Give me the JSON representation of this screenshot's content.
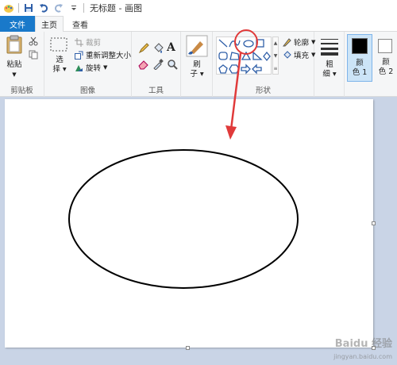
{
  "window": {
    "title": "无标题 - 画图"
  },
  "tabs": [
    {
      "label": "文件"
    },
    {
      "label": "主页"
    },
    {
      "label": "查看"
    }
  ],
  "ribbon": {
    "clipboard": {
      "paste_label": "粘贴",
      "group_label": "剪贴板"
    },
    "image": {
      "select_label_1": "选",
      "select_label_2": "择",
      "crop_label": "裁剪",
      "resize_label": "重新调整大小",
      "rotate_label": "旋转",
      "group_label": "图像"
    },
    "tools": {
      "text_tool": "A",
      "group_label": "工具"
    },
    "brushes": {
      "label_1": "刷",
      "label_2": "子"
    },
    "shapes": {
      "outline_label": "轮廓",
      "fill_label": "填充",
      "group_label": "形状"
    },
    "size": {
      "label_1": "粗",
      "label_2": "细"
    },
    "colors": {
      "color1_label_1": "颜",
      "color1_label_2": "色 1",
      "color2_label_1": "颜",
      "color2_label_2": "色 2",
      "color1_value": "#000000",
      "color2_value": "#ffffff"
    }
  },
  "annotation": {
    "color": "#e03a3a"
  },
  "watermark": {
    "brand": "Baidu 经验",
    "url": "jingyan.baidu.com"
  },
  "colors": {
    "accent": "#1979ca",
    "ribbon_bg": "#f5f6f7",
    "workspace_bg": "#c9d4e6"
  }
}
